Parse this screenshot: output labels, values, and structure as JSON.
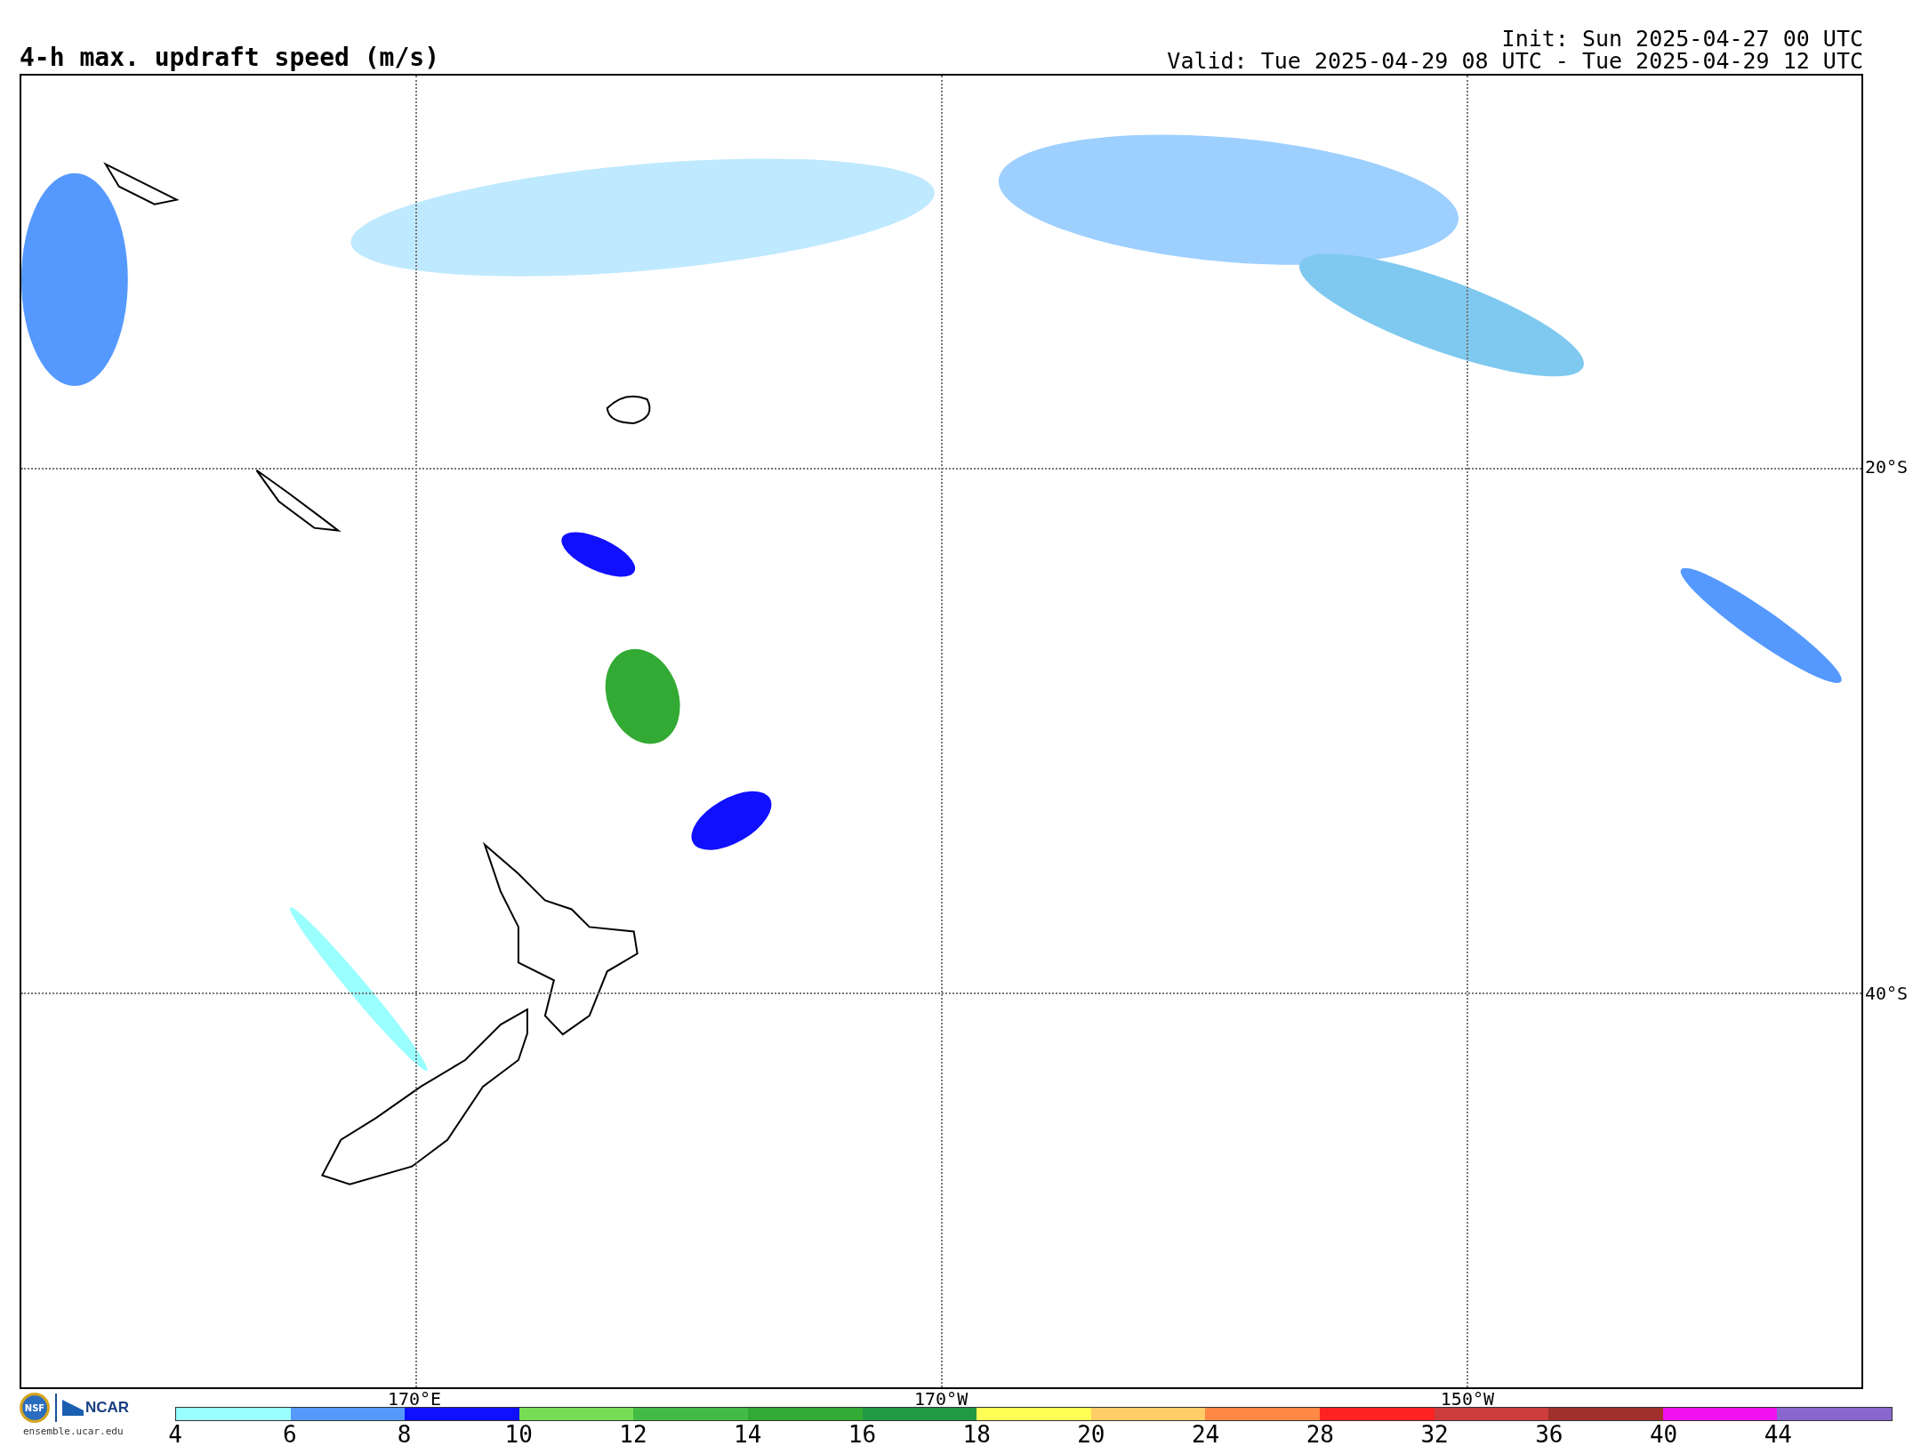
{
  "title": "4-h max. updraft speed (m/s)",
  "init": "Init: Sun 2025-04-27 00 UTC",
  "valid": "Valid: Tue 2025-04-29 08 UTC - Tue 2025-04-29 12 UTC",
  "map": {
    "longitude_labels": [
      "170°E",
      "170°W",
      "150°W"
    ],
    "latitude_labels": [
      "20°S",
      "40°S"
    ]
  },
  "logo": {
    "emblem": "NSF",
    "org": "NCAR",
    "site": "ensemble.ucar.edu"
  },
  "colorbar": {
    "bins": [
      {
        "color": "#99ffff"
      },
      {
        "color": "#5599ff"
      },
      {
        "color": "#1010ff"
      },
      {
        "color": "#77dd55"
      },
      {
        "color": "#44bb44"
      },
      {
        "color": "#33aa33"
      },
      {
        "color": "#229944"
      },
      {
        "color": "#ffff55"
      },
      {
        "color": "#ffcc66"
      },
      {
        "color": "#ff8844"
      },
      {
        "color": "#ff2222"
      },
      {
        "color": "#cc3c3c"
      },
      {
        "color": "#a0302c"
      },
      {
        "color": "#ee11ee"
      },
      {
        "color": "#8866cc"
      }
    ],
    "ticks": [
      "4",
      "6",
      "8",
      "10",
      "12",
      "14",
      "16",
      "18",
      "20",
      "24",
      "28",
      "32",
      "36",
      "40",
      "44"
    ]
  }
}
